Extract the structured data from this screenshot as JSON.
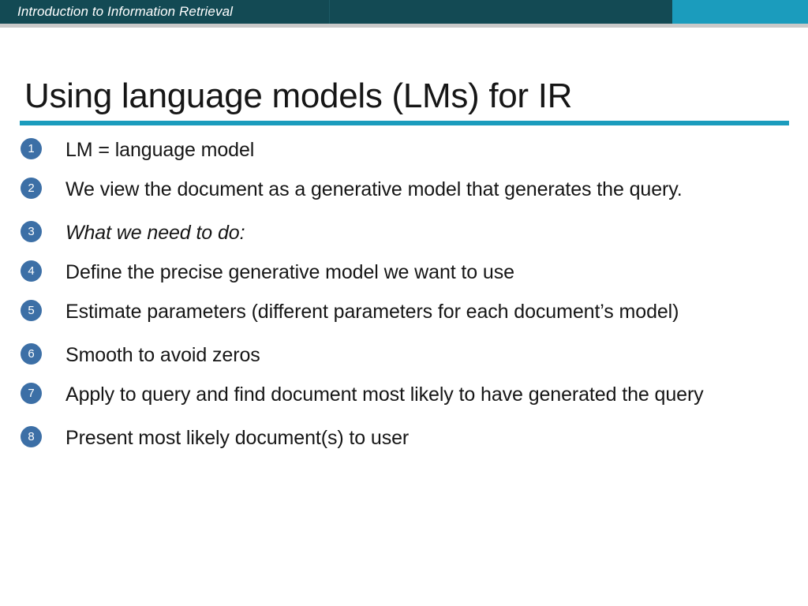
{
  "header": {
    "title": "Introduction to Information Retrieval",
    "bar_color": "#134a54",
    "accent_color": "#1b9cbd"
  },
  "slide": {
    "title": "Using language models (LMs) for IR",
    "rule_color": "#1b9cbd",
    "marker_color": "#3c6fa6",
    "bullets": [
      {
        "num": "1",
        "text": "LM = language model",
        "italic": false
      },
      {
        "num": "2",
        "text": "We view the document as a generative model that generates the query.",
        "italic": false
      },
      {
        "num": "3",
        "text": "What we need to do:",
        "italic": true
      },
      {
        "num": "4",
        "text": "Define the precise generative model we want to use",
        "italic": false
      },
      {
        "num": "5",
        "text": "Estimate parameters (different parameters for each document’s model)",
        "italic": false
      },
      {
        "num": "6",
        "text": "Smooth to avoid zeros",
        "italic": false
      },
      {
        "num": "7",
        "text": "Apply to query and find document most likely to have generated the query",
        "italic": false
      },
      {
        "num": "8",
        "text": "Present most likely document(s) to user",
        "italic": false
      }
    ]
  }
}
